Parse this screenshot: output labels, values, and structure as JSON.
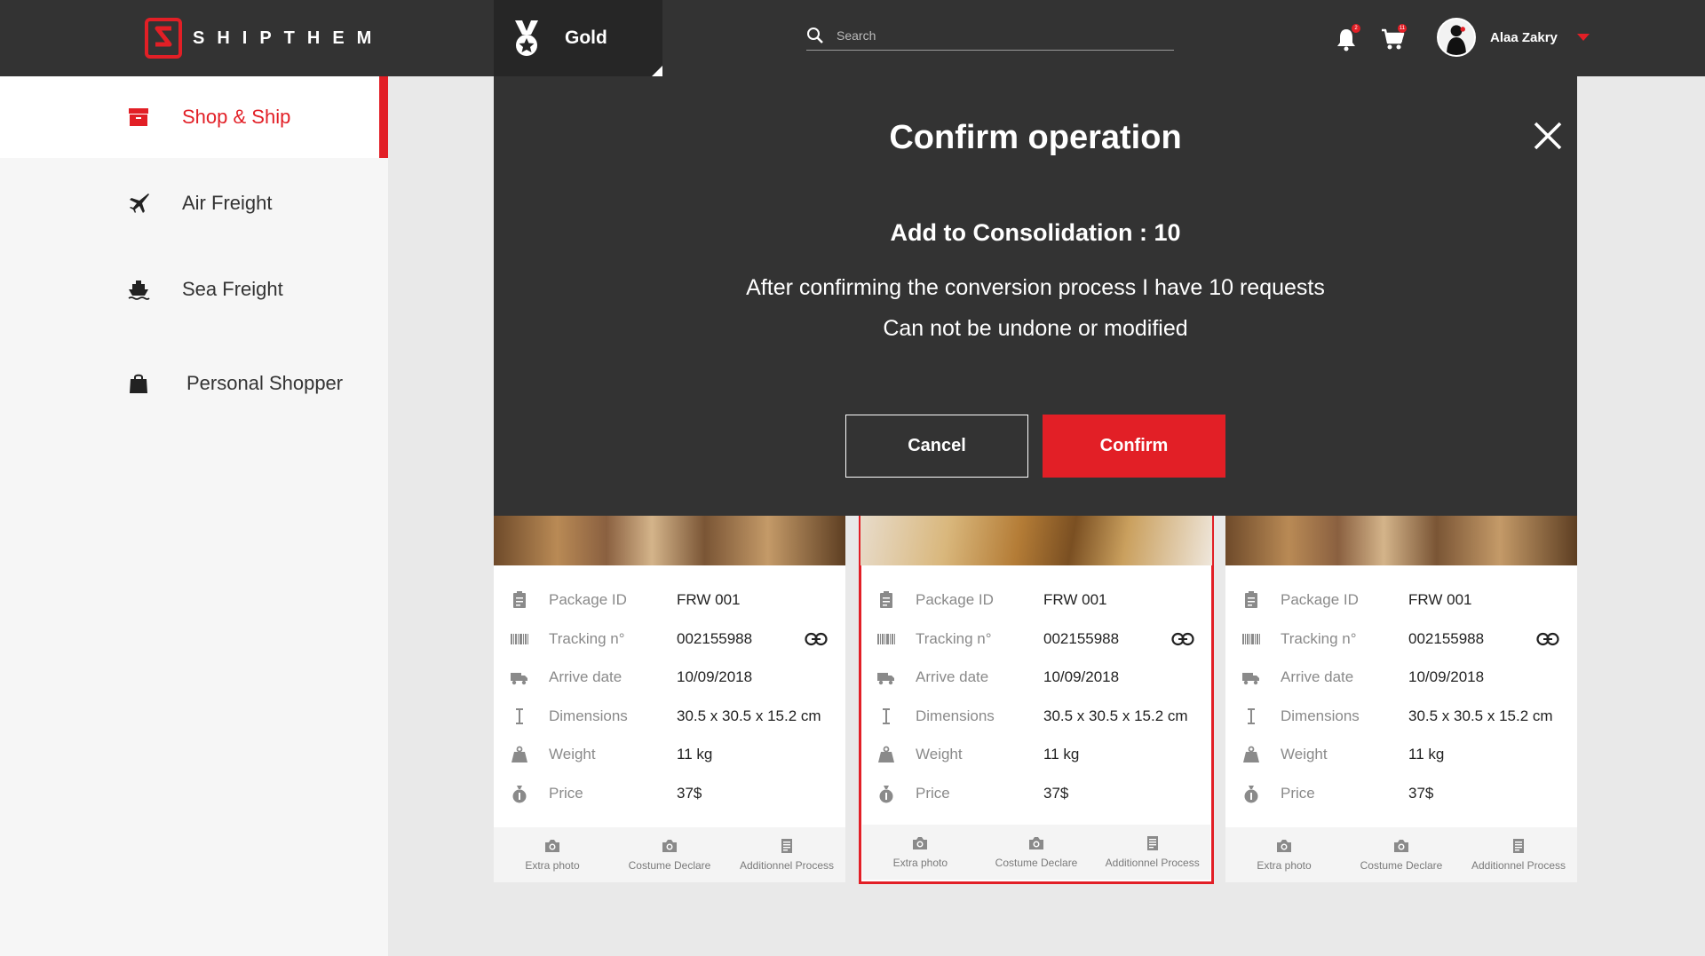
{
  "brand": {
    "name": "SHIPTHEM",
    "accent": "#e21f26",
    "dark": "#333333"
  },
  "header": {
    "tier_label": "Gold",
    "search_placeholder": "Search",
    "notifications_count": "2",
    "cart_count": "11",
    "user_name": "Alaa Zakry"
  },
  "sidebar": {
    "items": [
      {
        "label": "Shop & Ship",
        "icon": "box-icon",
        "active": true
      },
      {
        "label": "Air Freight",
        "icon": "airplane-icon",
        "active": false
      },
      {
        "label": "Sea Freight",
        "icon": "ship-icon",
        "active": false
      },
      {
        "label": "Personal Shopper",
        "icon": "shopping-bag-icon",
        "active": false
      }
    ]
  },
  "modal": {
    "title": "Confirm operation",
    "subtitle": "Add to Consolidation : 10",
    "line1": "After confirming the conversion process I have 10 requests",
    "line2": "Can not be undone or modified",
    "cancel_label": "Cancel",
    "confirm_label": "Confirm"
  },
  "card_labels": {
    "package_id": "Package ID",
    "tracking": "Tracking n°",
    "arrive_date": "Arrive date",
    "dimensions": "Dimensions",
    "weight": "Weight",
    "price": "Price"
  },
  "card_actions": {
    "extra_photo": "Extra photo",
    "costume_declare": "Costume Declare",
    "additionnel_process": "Additionnel Process"
  },
  "cards": [
    {
      "package_id": "FRW 001",
      "tracking": "002155988",
      "arrive_date": "10/09/2018",
      "dimensions": "30.5 x 30.5 x 15.2 cm",
      "weight": "11 kg",
      "price": "37$",
      "selected": false
    },
    {
      "package_id": "FRW 001",
      "tracking": "002155988",
      "arrive_date": "10/09/2018",
      "dimensions": "30.5 x 30.5 x 15.2 cm",
      "weight": "11 kg",
      "price": "37$",
      "selected": true
    },
    {
      "package_id": "FRW 001",
      "tracking": "002155988",
      "arrive_date": "10/09/2018",
      "dimensions": "30.5 x 30.5 x 15.2 cm",
      "weight": "11 kg",
      "price": "37$",
      "selected": false
    }
  ]
}
